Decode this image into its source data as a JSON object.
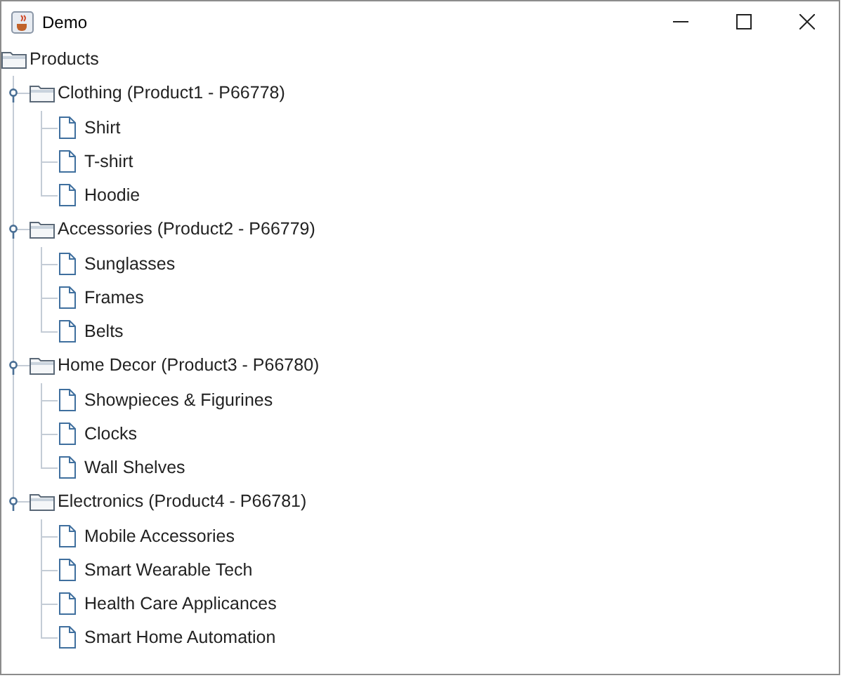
{
  "window": {
    "title": "Demo"
  },
  "tree": {
    "label": "Products",
    "children": [
      {
        "label": "Clothing (Product1 - P66778)",
        "expanded": true,
        "children": [
          {
            "label": "Shirt"
          },
          {
            "label": "T-shirt"
          },
          {
            "label": "Hoodie"
          }
        ]
      },
      {
        "label": "Accessories (Product2 - P66779)",
        "expanded": true,
        "children": [
          {
            "label": "Sunglasses"
          },
          {
            "label": "Frames"
          },
          {
            "label": "Belts"
          }
        ]
      },
      {
        "label": "Home Decor (Product3 - P66780)",
        "expanded": true,
        "children": [
          {
            "label": "Showpieces & Figurines"
          },
          {
            "label": "Clocks"
          },
          {
            "label": "Wall Shelves"
          }
        ]
      },
      {
        "label": "Electronics (Product4 - P66781)",
        "expanded": true,
        "children": [
          {
            "label": "Mobile Accessories"
          },
          {
            "label": "Smart Wearable Tech"
          },
          {
            "label": "Health Care Applicances"
          },
          {
            "label": "Smart Home Automation"
          }
        ]
      }
    ]
  }
}
